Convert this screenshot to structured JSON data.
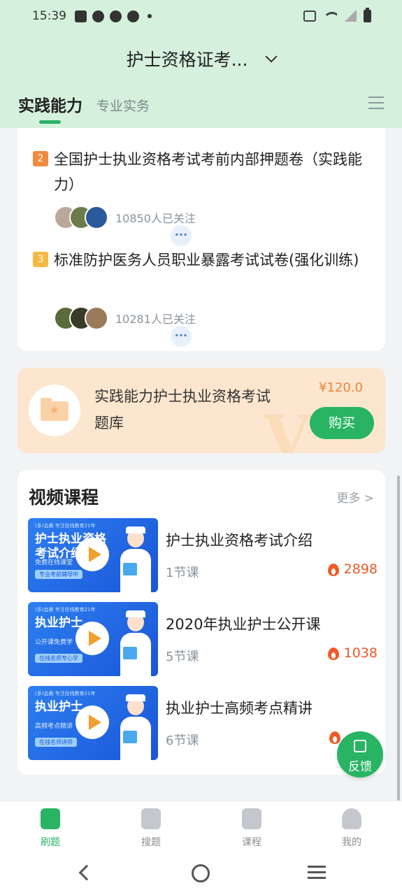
{
  "status_bar": {
    "time": "15:39"
  },
  "header": {
    "title": "护士资格证考...",
    "tabs": [
      {
        "label": "实践能力",
        "active": true
      },
      {
        "label": "专业实务",
        "active": false
      }
    ]
  },
  "exam_list": [
    {
      "rank": "2",
      "title": "全国护士执业资格考试考前内部押题卷（实践能力）",
      "followers": "10850人已关注",
      "rank_color": "#f08a3c"
    },
    {
      "rank": "3",
      "title": "标准防护医务人员职业暴露考试试卷(强化训练)",
      "followers": "10281人已关注",
      "rank_color": "#f5b942"
    }
  ],
  "avatar_more": "···",
  "purchase": {
    "title": "实践能力护士执业资格考试题库",
    "price": "¥120.0",
    "buy_label": "购买"
  },
  "video_section": {
    "title": "视频课程",
    "more_label": "更多 >",
    "courses": [
      {
        "title": "护士执业资格考试介绍",
        "lessons": "1节课",
        "hot": "2898",
        "thumb": {
          "brand": "(多)会晨  专注在线教育21年",
          "headline": "护士执业资格考试介绍",
          "sub": "免费在线课堂",
          "tag": "专业考前辅导中"
        }
      },
      {
        "title": "2020年执业护士公开课",
        "lessons": "5节课",
        "hot": "1038",
        "thumb": {
          "brand": "(多)会晨  专注在线教育21年",
          "headline": "执业护士",
          "sub": "公开课免费学",
          "tag": "在线名师专心学"
        }
      },
      {
        "title": "执业护士高频考点精讲",
        "lessons": "6节课",
        "hot": "",
        "thumb": {
          "brand": "(多)会晨  专注在线教育21年",
          "headline": "执业护士",
          "sub": "高频考点精讲",
          "tag": "在线名师讲师"
        }
      }
    ]
  },
  "feedback": {
    "label": "反馈"
  },
  "bottom_nav": [
    {
      "label": "刷题",
      "active": true
    },
    {
      "label": "搜题",
      "active": false
    },
    {
      "label": "课程",
      "active": false
    },
    {
      "label": "我的",
      "active": false
    }
  ],
  "colors": {
    "accent": "#28b463",
    "header_bg": "#d5f0dc",
    "price": "#e8863a"
  }
}
